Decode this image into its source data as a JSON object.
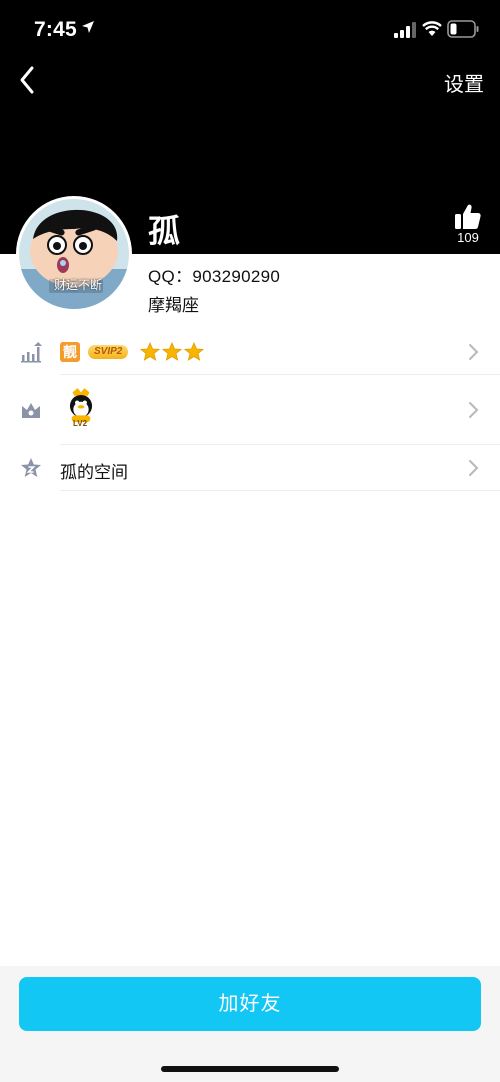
{
  "status_bar": {
    "time": "7:45"
  },
  "header": {
    "settings_label": "设置"
  },
  "profile": {
    "name": "孤",
    "likes": "109",
    "qq": "QQ：903290290",
    "zodiac": "摩羯座",
    "avatar_caption": "财运不断"
  },
  "rows": {
    "vip": {
      "badge_liang": "靓",
      "badge_svip": "SVIP2",
      "stars": 3
    },
    "level": {
      "level_text": "LV2"
    },
    "space": {
      "label": "孤的空间"
    }
  },
  "actions": {
    "add_friend_label": "加好友"
  },
  "colors": {
    "accent": "#12c7f4",
    "header_bg": "#000000",
    "star": "#f7b500",
    "liang_badge": "#f39b2b"
  },
  "icons": [
    "location-arrow-icon",
    "signal-icon",
    "wifi-icon",
    "battery-icon",
    "back-chevron-icon",
    "thumbs-up-icon",
    "growth-chart-icon",
    "crown-icon",
    "star-z-icon",
    "chevron-right-icon",
    "star-icon",
    "qq-penguin-icon"
  ]
}
